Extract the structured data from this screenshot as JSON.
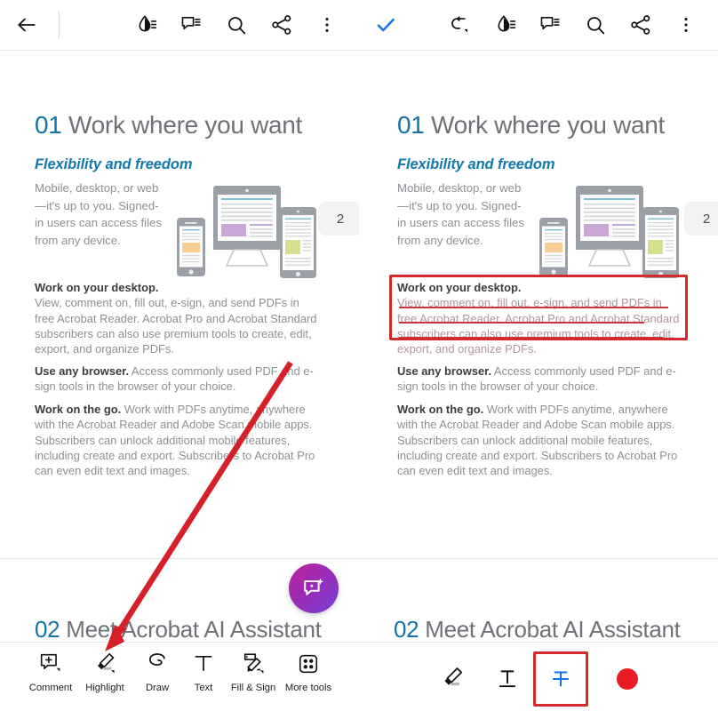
{
  "top_toolbar": {
    "left_group": [
      {
        "name": "back-arrow-icon",
        "label": "Back"
      },
      {
        "name": "highlight-drop-icon",
        "label": "Highlight"
      },
      {
        "name": "comment-icon",
        "label": "Comment"
      },
      {
        "name": "search-icon",
        "label": "Search"
      },
      {
        "name": "share-icon",
        "label": "Share"
      },
      {
        "name": "more-options-icon",
        "label": "More options"
      }
    ],
    "right_group": [
      {
        "name": "check-done-icon",
        "label": "Done"
      },
      {
        "name": "undo-icon",
        "label": "Undo"
      },
      {
        "name": "highlight-drop-icon",
        "label": "Highlight"
      },
      {
        "name": "comment-icon",
        "label": "Comment"
      },
      {
        "name": "search-icon",
        "label": "Search"
      },
      {
        "name": "share-icon",
        "label": "Share"
      },
      {
        "name": "more-options-icon",
        "label": "More options"
      }
    ]
  },
  "document": {
    "heading_number": "01",
    "heading_text": " Work where you want",
    "subheading": "Flexibility and freedom",
    "page_badge": "2",
    "intro": "Mobile, desktop, or web—it's up to you. Signed-in users can access files from any device.",
    "paragraphs": [
      {
        "lead": "Work on your desktop.",
        "body": "View, comment on, fill out, e-sign, and send PDFs in free Acrobat Reader. Acrobat Pro and Acrobat Standard subscribers can also use premium tools to create, edit, export, and organize PDFs."
      },
      {
        "lead": "Use any browser.",
        "body": " Access commonly used PDF and e-sign tools in the browser of your choice."
      },
      {
        "lead": "Work on the go.",
        "body": " Work with PDFs anytime, anywhere with the Acrobat Reader and Adobe Scan mobile apps. Subscribers can unlock additional mobile features, including create and export. Subscribers to Acrobat Pro can even edit text and images."
      }
    ],
    "section_two_number": "02",
    "section_two_text": " Meet Acrobat AI Assistant"
  },
  "annotation": {
    "type": "strikethrough",
    "color": "#c9353f",
    "struck_text": "View, comment on, fill out, e-sign, and send PDFs in free Acrobat Reader. Acrobat Pro and Acrobat Standard subscribers can also use premium tools to create,",
    "highlight_box_color": "#d32b2b"
  },
  "fab": {
    "name": "ai-assistant-button",
    "label": "AI Assistant",
    "gradient_from": "#c0249a",
    "gradient_to": "#7540d8"
  },
  "bottom_toolbar_left": {
    "tools": [
      {
        "name": "comment-tool",
        "label": "Comment",
        "icon": "comment-plus-icon",
        "has_caret": true
      },
      {
        "name": "highlight-tool",
        "label": "Highlight",
        "icon": "marker-pen-icon",
        "has_caret": true
      },
      {
        "name": "draw-tool",
        "label": "Draw",
        "icon": "draw-loop-icon",
        "has_caret": false
      },
      {
        "name": "text-tool",
        "label": "Text",
        "icon": "text-t-icon",
        "has_caret": false
      },
      {
        "name": "fill-sign-tool",
        "label": "Fill & Sign",
        "icon": "fill-sign-icon",
        "has_caret": true
      },
      {
        "name": "more-tools",
        "label": "More tools",
        "icon": "grid-dots-icon",
        "has_caret": false
      }
    ]
  },
  "bottom_toolbar_right": {
    "tools": [
      {
        "name": "highlight-tool",
        "label": "Highlight",
        "icon": "marker-pen-icon",
        "selected": false
      },
      {
        "name": "underline-tool",
        "label": "Underline",
        "icon": "underline-t-icon",
        "selected": false
      },
      {
        "name": "strikethrough-tool",
        "label": "Strikethrough",
        "icon": "strikethrough-t-icon",
        "selected": true
      }
    ],
    "color_swatch": {
      "name": "color-swatch-red",
      "label": "Red",
      "color": "#e81c23"
    }
  },
  "callout": {
    "name": "red-arrow-annotation",
    "color": "#d42026",
    "points_to": "highlight-tool"
  },
  "theme": {
    "heading_number_color": "#1473a6",
    "heading_text_color": "#6e7277",
    "subheading_color": "#1379ab",
    "body_color": "#8c9094",
    "lead_color": "#3c3c3c",
    "accent_blue": "#1473e8"
  }
}
